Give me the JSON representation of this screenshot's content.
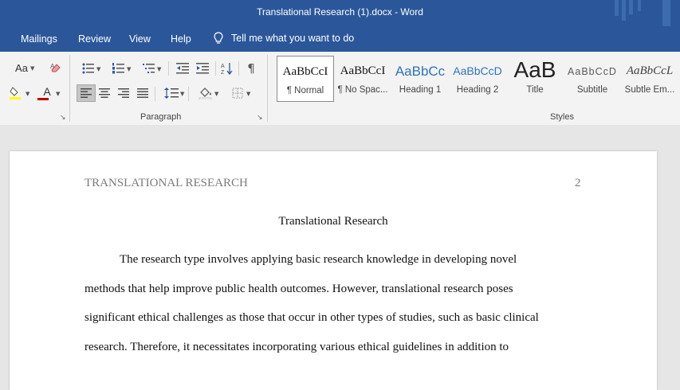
{
  "window": {
    "title": "Translational Research (1).docx  -  Word"
  },
  "ribbon_tabs": [
    "Mailings",
    "Review",
    "View",
    "Help"
  ],
  "tell_me": {
    "text": "Tell me what you want to do",
    "icon": "lightbulb-icon"
  },
  "font_group": {
    "change_case_label": "Aa",
    "clear_formatting_icon": "eraser-icon",
    "highlight_icon": "highlighter-icon",
    "highlight_color": "#ffff00",
    "font_color_label": "A",
    "font_color": "#c00000"
  },
  "paragraph_group": {
    "label": "Paragraph",
    "buttons": [
      "bullets",
      "numbering",
      "multilevel-list",
      "decrease-indent",
      "increase-indent",
      "sort",
      "show-formatting-marks",
      "align-left",
      "center",
      "align-right",
      "justify",
      "line-spacing",
      "shading",
      "borders"
    ],
    "active_alignment": "align-left"
  },
  "styles_group": {
    "label": "Styles",
    "items": [
      {
        "sample": "AaBbCcI",
        "name": "¶ Normal",
        "selected": true
      },
      {
        "sample": "AaBbCcI",
        "name": "¶ No Spac..."
      },
      {
        "sample": "AaBbCc",
        "name": "Heading 1"
      },
      {
        "sample": "AaBbCcD",
        "name": "Heading 2"
      },
      {
        "sample": "AaB",
        "name": "Title"
      },
      {
        "sample": "AaBbCcD",
        "name": "Subtitle"
      },
      {
        "sample": "AaBbCcL",
        "name": "Subtle Em..."
      }
    ]
  },
  "document": {
    "header": "TRANSLATIONAL RESEARCH",
    "page_number": "2",
    "title": "Translational Research",
    "lines": [
      "The research type involves applying basic research knowledge in developing novel",
      "methods that help improve public health outcomes. However, translational research poses",
      "significant ethical challenges as those that occur in other types of studies, such as basic clinical",
      "research. Therefore, it necessitates incorporating various ethical guidelines in addition to"
    ]
  },
  "colors": {
    "title_bar": "#2b579a",
    "ribbon": "#f3f3f3",
    "workspace": "#e6e6e6"
  }
}
